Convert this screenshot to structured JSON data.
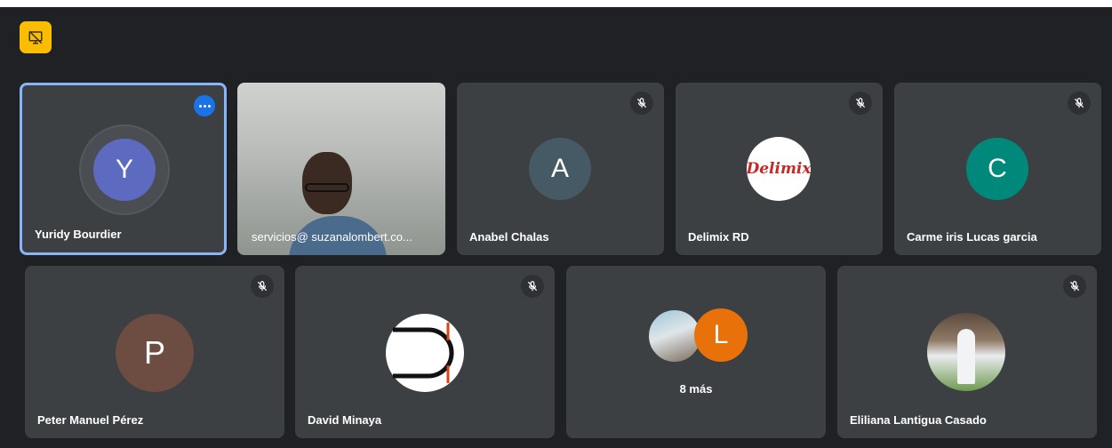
{
  "participants": [
    {
      "name": "Yuridy Bourdier",
      "initial": "Y",
      "avatar_color": "#5c6bc0",
      "muted": false,
      "active": true
    },
    {
      "name": "servicios@ suzanalombert.co...",
      "initial": "",
      "video": true,
      "muted": false
    },
    {
      "name": "Anabel Chalas",
      "initial": "A",
      "avatar_color": "#455a64",
      "muted": true
    },
    {
      "name": "Delimix RD",
      "logo_text": "Delimix",
      "muted": true
    },
    {
      "name": "Carme iris Lucas garcia",
      "initial": "C",
      "avatar_color": "#00897b",
      "muted": true
    },
    {
      "name": "Peter Manuel Pérez",
      "initial": "P",
      "avatar_color": "#6d4c41",
      "muted": true
    },
    {
      "name": "David Minaya",
      "initial": "",
      "muted": true
    },
    {
      "name": "",
      "initial": "L",
      "avatar_color": "#e8710a",
      "more_label": "8 más",
      "muted": false
    },
    {
      "name": "Eliliana Lantigua Casado",
      "initial": "",
      "muted": true
    }
  ],
  "icons": {
    "notice": "presentation-off-icon",
    "mute": "mic-off-icon",
    "more": "more-options-icon"
  },
  "colors": {
    "background": "#202124",
    "tile": "#3c4043",
    "active_border": "#8ab4f8",
    "notice": "#fbbc04"
  }
}
